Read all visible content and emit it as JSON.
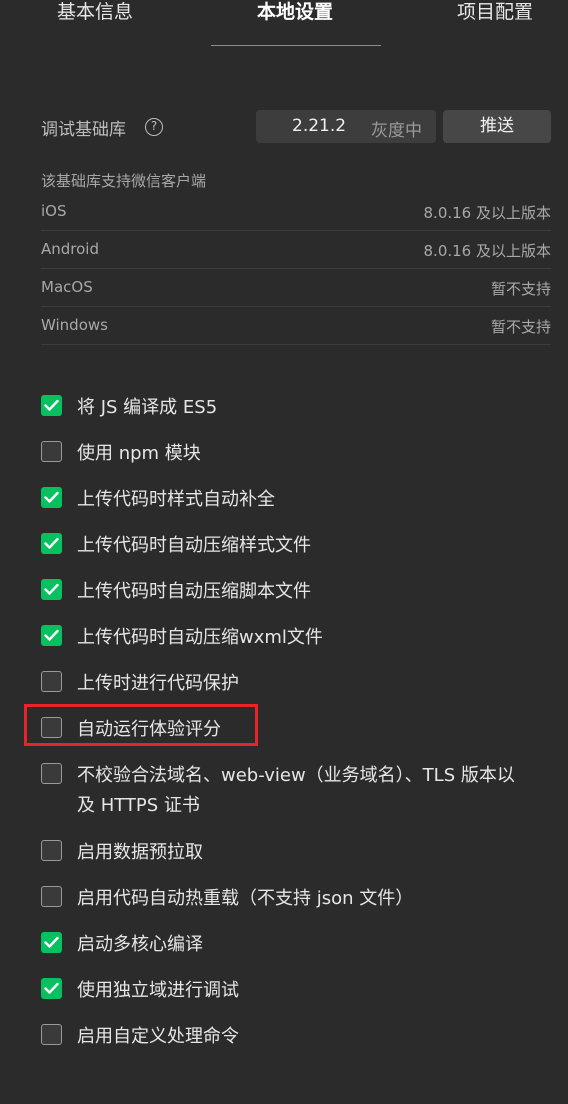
{
  "tabs": [
    {
      "label": "基本信息",
      "active": false
    },
    {
      "label": "本地设置",
      "active": true
    },
    {
      "label": "项目配置",
      "active": false
    }
  ],
  "debug_lib": {
    "label": "调试基础库",
    "help_icon": "question-circle-icon",
    "version": "2.21.2",
    "status": "灰度中",
    "push_label": "推送"
  },
  "support": {
    "title": "该基础库支持微信客户端",
    "rows": [
      {
        "os": "iOS",
        "version": "8.0.16 及以上版本"
      },
      {
        "os": "Android",
        "version": "8.0.16 及以上版本"
      },
      {
        "os": "MacOS",
        "version": "暂不支持"
      },
      {
        "os": "Windows",
        "version": "暂不支持"
      }
    ]
  },
  "options": [
    {
      "label": "将 JS 编译成 ES5",
      "checked": true
    },
    {
      "label": "使用 npm 模块",
      "checked": false
    },
    {
      "label": "上传代码时样式自动补全",
      "checked": true
    },
    {
      "label": "上传代码时自动压缩样式文件",
      "checked": true
    },
    {
      "label": "上传代码时自动压缩脚本文件",
      "checked": true
    },
    {
      "label": "上传代码时自动压缩wxml文件",
      "checked": true
    },
    {
      "label": "上传时进行代码保护",
      "checked": false
    },
    {
      "label": "自动运行体验评分",
      "checked": false,
      "highlighted": true
    },
    {
      "label": "不校验合法域名、web-view（业务域名）、TLS 版本以及 HTTPS 证书",
      "checked": false
    },
    {
      "label": "启用数据预拉取",
      "checked": false
    },
    {
      "label": "启用代码自动热重载（不支持 json 文件）",
      "checked": false
    },
    {
      "label": "启动多核心编译",
      "checked": true
    },
    {
      "label": "使用独立域进行调试",
      "checked": true
    },
    {
      "label": "启用自定义处理命令",
      "checked": false
    }
  ],
  "colors": {
    "background": "#2b2b2b",
    "checkbox_on": "#07c160",
    "highlight": "#e8242a"
  }
}
